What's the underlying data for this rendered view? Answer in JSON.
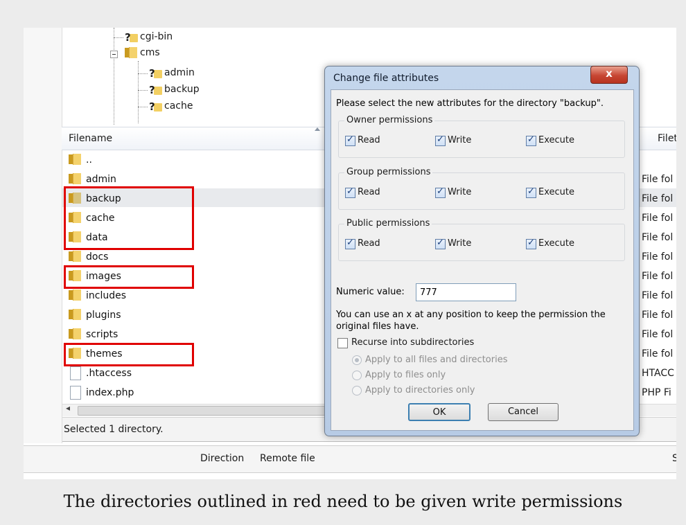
{
  "tree": {
    "items": [
      {
        "label": "cgi-bin"
      },
      {
        "label": "cms"
      },
      {
        "label": "admin"
      },
      {
        "label": "backup"
      },
      {
        "label": "cache"
      }
    ]
  },
  "list": {
    "columns": {
      "filename": "Filename",
      "filetype": "Filetyp"
    },
    "rows": [
      {
        "name": "..",
        "type": ""
      },
      {
        "name": "admin",
        "type": "File fol"
      },
      {
        "name": "backup",
        "type": "File fol"
      },
      {
        "name": "cache",
        "type": "File fol"
      },
      {
        "name": "data",
        "type": "File fol"
      },
      {
        "name": "docs",
        "type": "File fol"
      },
      {
        "name": "images",
        "type": "File fol"
      },
      {
        "name": "includes",
        "type": "File fol"
      },
      {
        "name": "plugins",
        "type": "File fol"
      },
      {
        "name": "scripts",
        "type": "File fol"
      },
      {
        "name": "themes",
        "type": "File fol"
      },
      {
        "name": ".htaccess",
        "type": "HTACC"
      },
      {
        "name": "index.php",
        "type": "PHP Fi"
      }
    ]
  },
  "status": {
    "text": "Selected 1 directory."
  },
  "queue": {
    "direction": "Direction",
    "remote": "Remote file",
    "col_s": "S"
  },
  "dialog": {
    "title": "Change file attributes",
    "close_glyph": "x",
    "prompt": "Please select the new attributes for the directory \"backup\".",
    "groups": [
      {
        "title": "Owner permissions",
        "read": "Read",
        "write": "Write",
        "execute": "Execute"
      },
      {
        "title": "Group permissions",
        "read": "Read",
        "write": "Write",
        "execute": "Execute"
      },
      {
        "title": "Public permissions",
        "read": "Read",
        "write": "Write",
        "execute": "Execute"
      }
    ],
    "numeric_label": "Numeric value:",
    "numeric_value": "777",
    "hint_line1": "You can use an x at any position to keep the permission the",
    "hint_line2": "original files have.",
    "recurse_label": "Recurse into subdirectories",
    "radios": [
      "Apply to all files and directories",
      "Apply to files only",
      "Apply to directories only"
    ],
    "ok": "OK",
    "cancel": "Cancel"
  },
  "caption": "The directories outlined in red need to be given write permissions"
}
